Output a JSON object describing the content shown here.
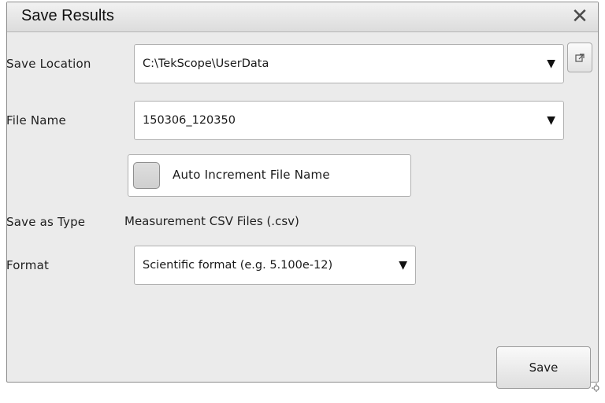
{
  "dialog": {
    "title": "Save Results",
    "close_icon": "close-icon"
  },
  "save_location": {
    "label": "Save Location",
    "value": "C:\\TekScope\\UserData",
    "dropdown_icon": "▼",
    "browse_icon": "external-link-icon"
  },
  "file_name": {
    "label": "File Name",
    "value": "150306_120350",
    "dropdown_icon": "▼"
  },
  "auto_increment": {
    "label": "Auto Increment File Name",
    "checked": false
  },
  "save_as_type": {
    "label": "Save as Type",
    "value": "Measurement CSV Files (.csv)"
  },
  "format": {
    "label": "Format",
    "value": "Scientific format (e.g. 5.100e-12)",
    "dropdown_icon": "▼"
  },
  "actions": {
    "save_label": "Save"
  }
}
